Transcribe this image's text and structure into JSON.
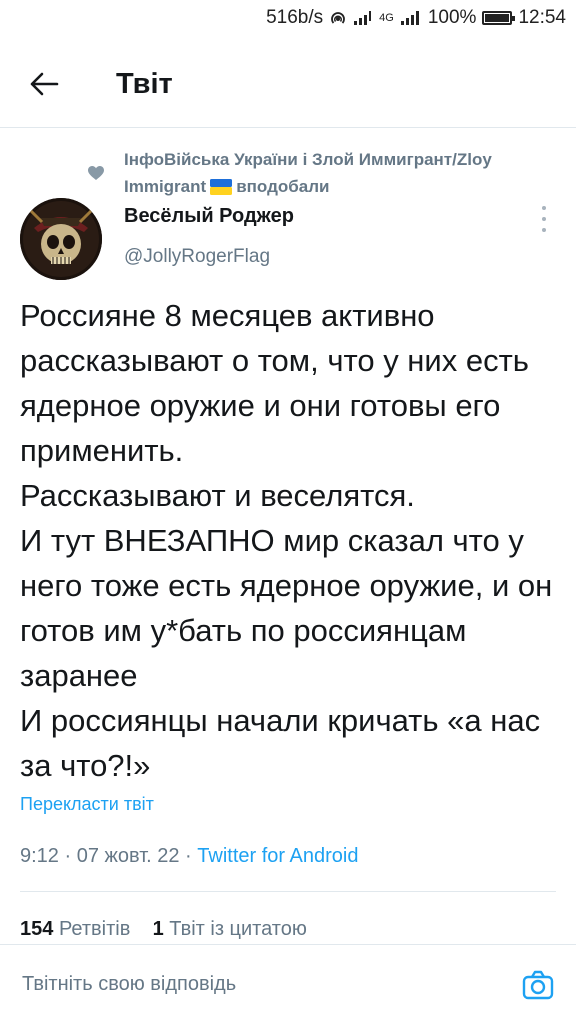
{
  "status_bar": {
    "speed": "516b/s",
    "network_type": "4G",
    "battery": "100%",
    "time": "12:54"
  },
  "header": {
    "title": "Твіт"
  },
  "social_context": {
    "text_before_flag": "ІнфоВійська України і Злой Иммигрант/Zloy Immigrant",
    "text_after_flag": "вподобали"
  },
  "author": {
    "name": "Весёлый Роджер",
    "handle": "@JollyRogerFlag"
  },
  "tweet": {
    "text": "Россияне 8 месяцев активно рассказывают о том, что у них есть ядерное оружие и они готовы его применить.\nРассказывают и веселятся.\nИ тут ВНЕЗАПНО мир сказал что у него тоже есть ядерное оружие, и он готов им у*бать по россиянцам заранее\nИ россиянцы начали кричать «а нас за что?!»",
    "translate_label": "Перекласти твіт",
    "timestamp": "9:12 · 07 жовт. 22 ·",
    "source": "Twitter for Android"
  },
  "stats": {
    "retweets_count": "154",
    "retweets_label": "Ретвітів",
    "quotes_count": "1",
    "quotes_label": "Твіт із цитатою"
  },
  "reply": {
    "placeholder": "Твітніть свою відповідь"
  },
  "colors": {
    "accent": "#1da1f2",
    "secondary_text": "#657786",
    "primary_text": "#14171a",
    "divider": "#e1e8ed"
  }
}
